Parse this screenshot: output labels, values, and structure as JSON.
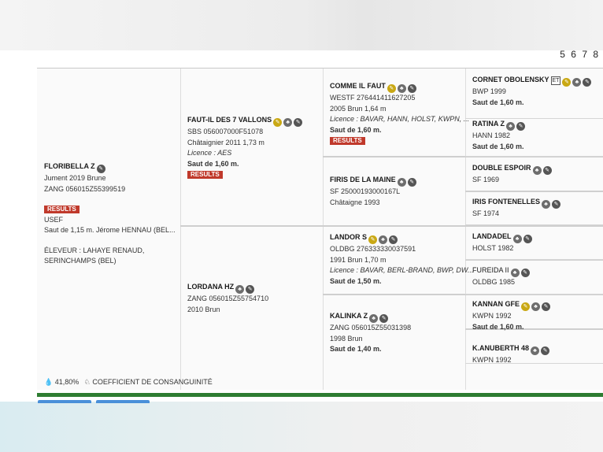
{
  "generations": "5 6 7 8",
  "results_label": "RESULTS",
  "subject": {
    "name": "FLORIBELLA Z",
    "line1": "Jument 2019 Brune",
    "line2": "ZANG 056015Z55399519",
    "line3": "USEF",
    "line4": "Saut de 1,15 m. Jérome HENNAU (BEL...",
    "breeder": "ÉLEVEUR : LAHAYE RENAUD,",
    "breeder2": "SERINCHAMPS (BEL)"
  },
  "sire": {
    "name": "FAUT-IL DES 7 VALLONS",
    "line1": "SBS 056007000F51078",
    "line2": "Châtaignier 2011 1,73 m",
    "licence": "Licence : AES",
    "saut": "Saut de 1,60 m."
  },
  "dam": {
    "name": "LORDANA HZ",
    "line1": "ZANG 056015Z55754710",
    "line2": "2010 Brun"
  },
  "gen3": [
    {
      "name": "COMME IL FAUT",
      "line1": "WESTF 276441411627205",
      "line2": "2005 Brun 1,64 m",
      "licence": "Licence : BAVAR, HANN, HOLST, KWPN, ...",
      "saut": "Saut de 1,60 m."
    },
    {
      "name": "FIRIS DE LA MAINE",
      "line1": "SF 25000193000167L",
      "line2": "Châtaigne 1993"
    },
    {
      "name": "LANDOR S",
      "line1": "OLDBG 276333330037591",
      "line2": "1991 Brun 1,70 m",
      "licence": "Licence : BAVAR, BERL-BRAND, BWP, DW...",
      "saut": "Saut de 1,50 m."
    },
    {
      "name": "KALINKA Z",
      "line1": "ZANG 056015Z55031398",
      "line2": "1998 Brun",
      "saut": "Saut de 1,40 m."
    }
  ],
  "gen4": [
    {
      "name": "CORNET OBOLENSKY",
      "tag": "ET",
      "line1": "BWP 1999",
      "saut": "Saut de 1,60 m."
    },
    {
      "name": "RATINA Z",
      "line1": "HANN 1982",
      "saut": "Saut de 1,60 m."
    },
    {
      "name": "DOUBLE ESPOIR",
      "line1": "SF 1969"
    },
    {
      "name": "IRIS FONTENELLES",
      "line1": "SF 1974"
    },
    {
      "name": "LANDADEL",
      "line1": "HOLST 1982"
    },
    {
      "name": "FUREIDA II",
      "line1": "OLDBG 1985"
    },
    {
      "name": "KANNAN GFE",
      "line1": "KWPN 1992",
      "saut": "Saut de 1,60 m."
    },
    {
      "name": "K.ANUBERTH 48",
      "line1": "KWPN 1992"
    }
  ],
  "footer": {
    "percent": "41,80%",
    "label": "COEFFICIENT DE CONSANGUINITÉ"
  }
}
